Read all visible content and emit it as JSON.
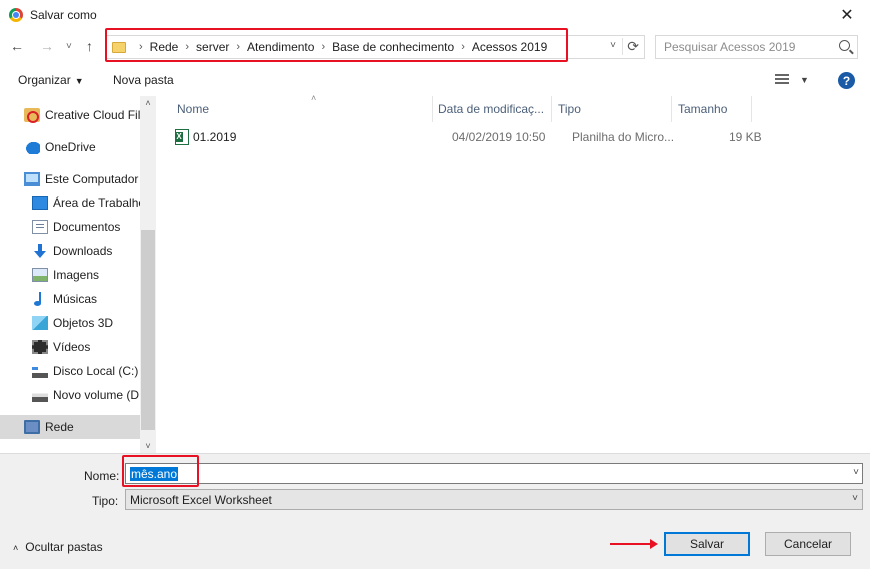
{
  "window": {
    "title": "Salvar como",
    "close_glyph": "✕"
  },
  "nav": {
    "back_glyph": "←",
    "forward_glyph": "→",
    "recent_glyph": "˅",
    "up_glyph": "↑",
    "breadcrumb": [
      "Rede",
      "server",
      "Atendimento",
      "Base de conhecimento",
      "Acessos 2019"
    ],
    "separator": "›",
    "dropdown_glyph": "˅",
    "refresh_glyph": "⟳",
    "search_placeholder": "Pesquisar Acessos 2019"
  },
  "toolbar": {
    "organize_label": "Organizar",
    "organize_dd": "▼",
    "new_folder_label": "Nova pasta",
    "view_dd": "▼",
    "help_label": "?"
  },
  "sidebar": {
    "items": [
      {
        "label": "Creative Cloud Fil",
        "icon": "creative-cloud-icon"
      },
      {
        "label": "OneDrive",
        "icon": "cloud-icon"
      },
      {
        "label": "Este Computador",
        "icon": "computer-icon"
      },
      {
        "label": "Área de Trabalho",
        "icon": "desktop-icon"
      },
      {
        "label": "Documentos",
        "icon": "documents-icon"
      },
      {
        "label": "Downloads",
        "icon": "downloads-icon"
      },
      {
        "label": "Imagens",
        "icon": "pictures-icon"
      },
      {
        "label": "Músicas",
        "icon": "music-icon"
      },
      {
        "label": "Objetos 3D",
        "icon": "3d-objects-icon"
      },
      {
        "label": "Vídeos",
        "icon": "videos-icon"
      },
      {
        "label": "Disco Local (C:)",
        "icon": "local-disk-icon"
      },
      {
        "label": "Novo volume (D",
        "icon": "drive-icon"
      },
      {
        "label": "Rede",
        "icon": "network-icon"
      }
    ],
    "selected": "Rede",
    "scroll_up": "˄",
    "scroll_down": "˅"
  },
  "filelist": {
    "columns": [
      "Nome",
      "Data de modificaç...",
      "Tipo",
      "Tamanho"
    ],
    "sort_glyph": "˄",
    "rows": [
      {
        "name": "01.2019",
        "date": "04/02/2019 10:50",
        "type": "Planilha do Micro...",
        "size": "19 KB"
      }
    ]
  },
  "form": {
    "name_label": "Nome:",
    "name_value": "mês.ano",
    "name_dd": "˅",
    "type_label": "Tipo:",
    "type_value": "Microsoft Excel Worksheet",
    "type_dd": "˅",
    "hide_folders_label": "Ocultar pastas",
    "hide_folders_glyph": "˄",
    "save_label": "Salvar",
    "cancel_label": "Cancelar"
  },
  "colors": {
    "highlight": "#e81123",
    "selection": "#0078d7"
  }
}
